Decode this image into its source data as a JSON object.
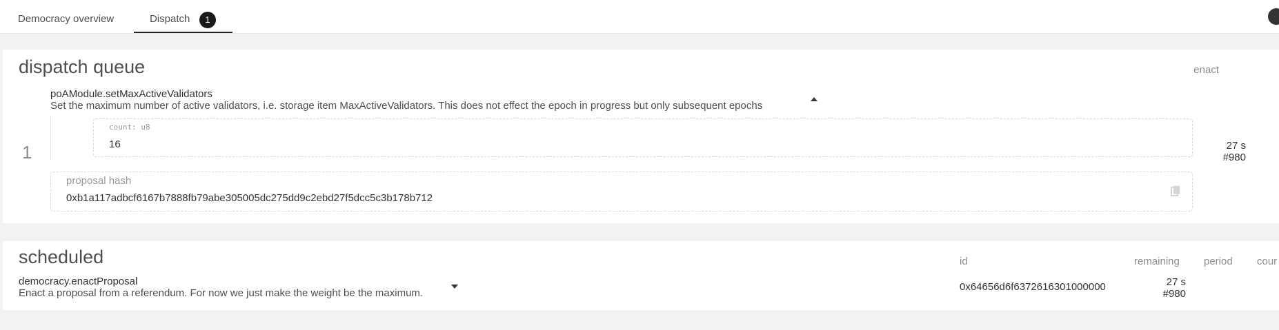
{
  "tabs": [
    {
      "label": "Democracy overview"
    },
    {
      "label": "Dispatch",
      "badge": "1"
    }
  ],
  "dispatch_queue": {
    "title": "dispatch queue",
    "column_enact": "enact",
    "item": {
      "index": "1",
      "method": "poAModule.setMaxActiveValidators",
      "description": "Set the maximum number of active validators, i.e. storage item MaxActiveValidators. This does not effect the epoch in progress but only subsequent epochs",
      "param_label": "count: u8",
      "param_value": "16",
      "proposal_hash_label": "proposal hash",
      "proposal_hash": "0xb1a117adbcf6167b7888fb79abe305005dc275dd9c2ebd27f5dcc5c3b178b712",
      "enact_time": "27 s",
      "enact_block": "#980"
    }
  },
  "scheduled": {
    "title": "scheduled",
    "columns": {
      "id": "id",
      "remaining": "remaining",
      "period": "period",
      "count": "cour"
    },
    "item": {
      "method": "democracy.enactProposal",
      "description": "Enact a proposal from a referendum. For now we just make the weight be the maximum.",
      "id": "0x64656d6f6372616301000000",
      "remaining_time": "27 s",
      "remaining_block": "#980"
    }
  }
}
